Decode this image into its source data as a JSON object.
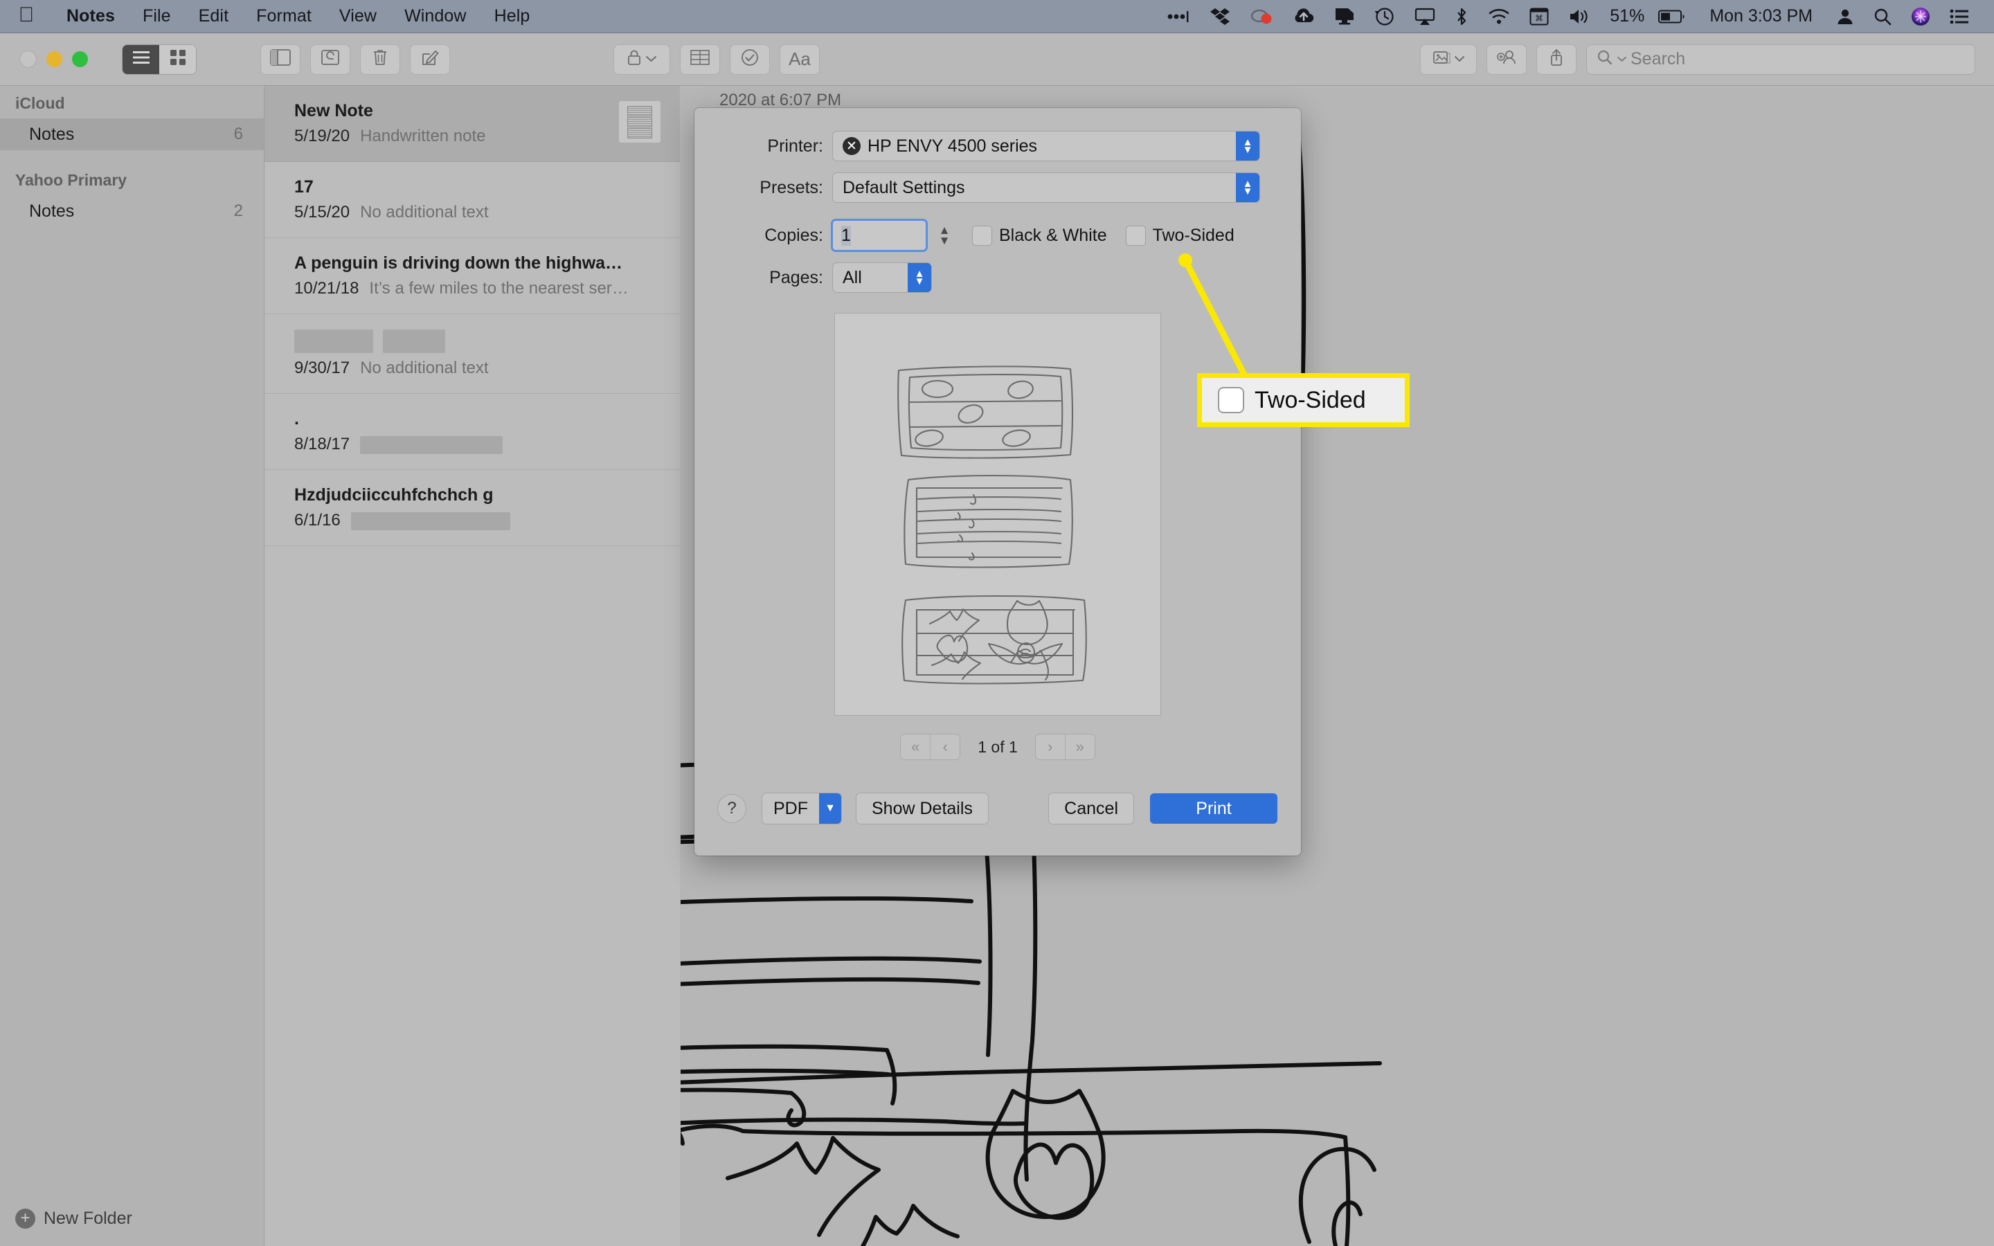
{
  "menubar": {
    "apple_icon": "apple-logo-icon",
    "items": [
      {
        "label": "Notes",
        "bold": true
      },
      {
        "label": "File"
      },
      {
        "label": "Edit"
      },
      {
        "label": "Format"
      },
      {
        "label": "View"
      },
      {
        "label": "Window"
      },
      {
        "label": "Help"
      }
    ],
    "status_icons": [
      "ellipsis-icon",
      "dropbox-icon",
      "cloud-record-icon",
      "cloud-upload-icon",
      "display-icon",
      "time-machine-icon",
      "airplay-icon",
      "bluetooth-icon",
      "wifi-icon",
      "keyboard-shortcut-icon",
      "volume-icon"
    ],
    "battery_percent": "51%",
    "battery_icon": "battery-icon",
    "clock": "Mon 3:03 PM",
    "right_icons": [
      "user-account-icon",
      "search-icon",
      "siri-icon",
      "control-center-icon"
    ]
  },
  "toolbar": {
    "traffic_lights": [
      "close-button",
      "minimize-button",
      "zoom-button"
    ],
    "view_segments": [
      {
        "name": "list-view-button",
        "icon": "list-icon",
        "active": true
      },
      {
        "name": "gallery-view-button",
        "icon": "grid-icon",
        "active": false
      }
    ],
    "left_buttons": [
      {
        "name": "sidebar-toggle-button",
        "icon": "sidebar-icon"
      },
      {
        "name": "attachments-button",
        "icon": "attachments-icon"
      },
      {
        "name": "delete-note-button",
        "icon": "trash-icon"
      },
      {
        "name": "new-note-button",
        "icon": "compose-icon"
      }
    ],
    "center_buttons": [
      {
        "name": "lock-note-button",
        "icon": "lock-icon",
        "has_chevron": true
      },
      {
        "name": "table-button",
        "icon": "table-icon"
      },
      {
        "name": "checklist-button",
        "icon": "checkmark-circle-icon"
      },
      {
        "name": "format-button",
        "icon": "aa-text-icon",
        "label": "Aa"
      }
    ],
    "right_buttons": [
      {
        "name": "media-button",
        "icon": "photo-icon",
        "has_chevron": true
      },
      {
        "name": "add-people-button",
        "icon": "add-person-icon"
      },
      {
        "name": "share-button",
        "icon": "share-icon"
      }
    ],
    "search": {
      "placeholder": "Search",
      "value": "",
      "icon": "search-icon"
    }
  },
  "sidebar": {
    "groups": [
      {
        "header": "iCloud",
        "items": [
          {
            "label": "Notes",
            "count": "6",
            "selected": true
          }
        ]
      },
      {
        "header": "Yahoo Primary",
        "items": [
          {
            "label": "Notes",
            "count": "2",
            "selected": false
          }
        ]
      }
    ],
    "new_folder": {
      "label": "New Folder",
      "icon": "plus-circle-icon"
    }
  },
  "notes_list": [
    {
      "title": "New Note",
      "date": "5/19/20",
      "snippet": "Handwritten note",
      "selected": true,
      "has_thumbnail": true,
      "title_redacted": false,
      "snippet_redacted": false
    },
    {
      "title": "17",
      "date": "5/15/20",
      "snippet": "No additional text",
      "selected": false,
      "has_thumbnail": false,
      "title_redacted": false,
      "snippet_redacted": false
    },
    {
      "title": "A penguin is driving down the highwa…",
      "date": "10/21/18",
      "snippet": "It’s a few miles to the nearest ser…",
      "selected": false,
      "has_thumbnail": false,
      "title_redacted": false,
      "snippet_redacted": false
    },
    {
      "title": "",
      "date": "9/30/17",
      "snippet": "No additional text",
      "selected": false,
      "has_thumbnail": false,
      "title_redacted": true,
      "snippet_redacted": false
    },
    {
      "title": ".",
      "date": "8/18/17",
      "snippet": "",
      "selected": false,
      "has_thumbnail": false,
      "title_redacted": false,
      "snippet_redacted": true
    },
    {
      "title": "Hzdjudciiccuhfchchch g",
      "date": "6/1/16",
      "snippet": "",
      "selected": false,
      "has_thumbnail": false,
      "title_redacted": false,
      "snippet_redacted": true
    }
  ],
  "editor": {
    "doc_date": "2020 at 6:07 PM",
    "content_description": "handwritten-drawing"
  },
  "print_dialog": {
    "printer": {
      "label": "Printer:",
      "value": "HP ENVY 4500 series",
      "icon": "printer-status-icon"
    },
    "presets": {
      "label": "Presets:",
      "value": "Default Settings"
    },
    "copies": {
      "label": "Copies:",
      "value": "1"
    },
    "black_and_white": {
      "label": "Black & White",
      "checked": false
    },
    "two_sided": {
      "label": "Two-Sided",
      "checked": false
    },
    "pages": {
      "label": "Pages:",
      "value": "All"
    },
    "pager": {
      "first_icon": "«",
      "prev_icon": "‹",
      "status": "1 of 1",
      "next_icon": "›",
      "last_icon": "»"
    },
    "help_label": "?",
    "pdf_label": "PDF",
    "show_details_label": "Show Details",
    "cancel_label": "Cancel",
    "print_label": "Print"
  },
  "callout": {
    "label": "Two-Sided",
    "checkbox_checked": false,
    "highlight_color": "#fbe800",
    "box_bg": "#eeeeee"
  },
  "colors": {
    "menubar_bg": "#8d96a5",
    "window_bg": "#b6b6b6",
    "accent_blue": "#2f6fd8",
    "highlight_yellow": "#fbe800",
    "sidebar_bg": "#b3b3b3",
    "list_bg": "#bcbcbc"
  }
}
